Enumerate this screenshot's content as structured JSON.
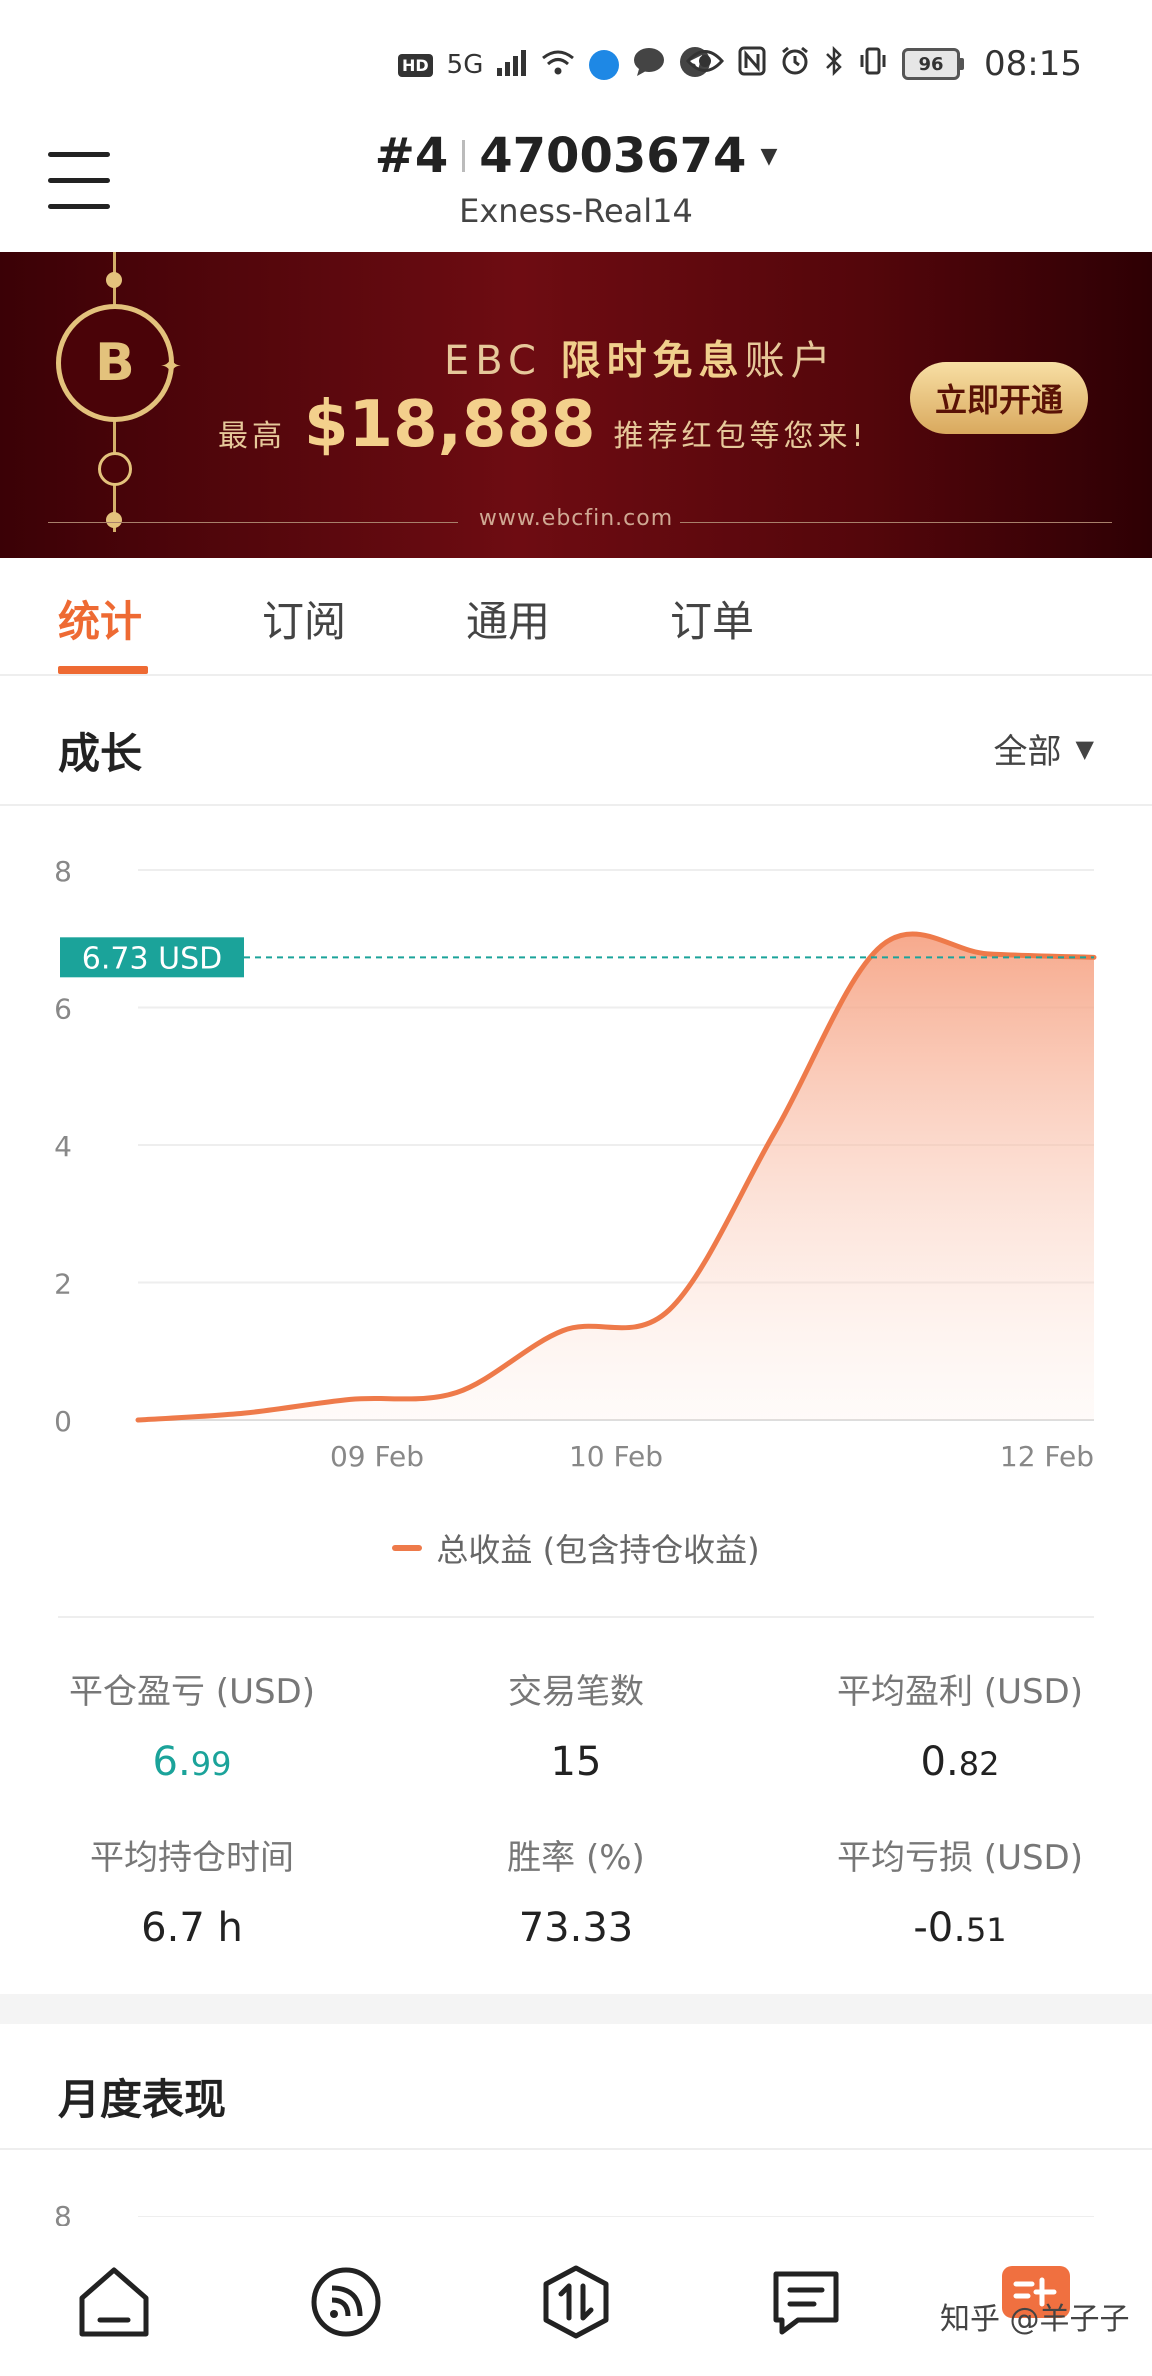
{
  "status_bar": {
    "hd": "HD",
    "network": "5G",
    "battery": "96",
    "time": "08:15"
  },
  "header": {
    "account_prefix": "#4",
    "account_number": "47003674",
    "server": "Exness-Real14"
  },
  "banner": {
    "brand": "EBC",
    "headline_pre": "EBC",
    "headline_highlight": "限时免息",
    "headline_post": "账户",
    "line2_pre": "最高",
    "amount": "$18,888",
    "line2_post": "推荐红包等您来!",
    "cta": "立即开通",
    "url": "www.ebcfin.com"
  },
  "tabs": [
    {
      "label": "统计",
      "active": true
    },
    {
      "label": "订阅",
      "active": false
    },
    {
      "label": "通用",
      "active": false
    },
    {
      "label": "订单",
      "active": false
    }
  ],
  "growth": {
    "title": "成长",
    "filter": "全部"
  },
  "chart_data": {
    "type": "area",
    "title": "",
    "xlabel": "",
    "ylabel": "",
    "x_ticks": [
      "09 Feb",
      "10 Feb",
      "12 Feb"
    ],
    "y_ticks": [
      "0",
      "2",
      "4",
      "6",
      "8"
    ],
    "ylim": [
      0,
      8
    ],
    "current_label": "6.73 USD",
    "current_value": 6.73,
    "series": [
      {
        "name": "总收益 (包含持仓收益)",
        "color": "#ee7a4a",
        "points": [
          {
            "x": "08 Feb",
            "y": 0.0
          },
          {
            "x": "08 Feb",
            "y": 0.1
          },
          {
            "x": "09 Feb",
            "y": 0.3
          },
          {
            "x": "09 Feb",
            "y": 0.4
          },
          {
            "x": "10 Feb",
            "y": 1.3
          },
          {
            "x": "10 Feb",
            "y": 1.6
          },
          {
            "x": "11 Feb",
            "y": 4.2
          },
          {
            "x": "11 Feb",
            "y": 6.9
          },
          {
            "x": "12 Feb",
            "y": 6.78
          },
          {
            "x": "12 Feb",
            "y": 6.73
          }
        ]
      }
    ]
  },
  "legend": {
    "label": "总收益 (包含持仓收益)"
  },
  "stats": [
    {
      "label": "平仓盈亏 (USD)",
      "value_main": "6.",
      "value_small": "99",
      "color": "#1ba39a"
    },
    {
      "label": "交易笔数",
      "value_main": "15",
      "value_small": ""
    },
    {
      "label": "平均盈利 (USD)",
      "value_main": "0.",
      "value_small": "82"
    },
    {
      "label": "平均持仓时间",
      "value_main": "6.7 h",
      "value_small": ""
    },
    {
      "label": "胜率 (%)",
      "value_main": "73.33",
      "value_small": ""
    },
    {
      "label": "平均亏损 (USD)",
      "value_main": "-0.",
      "value_small": "51"
    }
  ],
  "monthly": {
    "title": "月度表现",
    "first_tick": "8"
  },
  "bottom_nav": [
    {
      "icon": "home-icon"
    },
    {
      "icon": "feed-icon"
    },
    {
      "icon": "trade-icon"
    },
    {
      "icon": "messages-icon"
    },
    {
      "icon": "profile-icon"
    }
  ],
  "watermark": "知乎 @羊子子",
  "colors": {
    "accent": "#ee6a33",
    "positive": "#1ba39a",
    "banner_bg": "#5a0a10",
    "banner_gold": "#e3c27c"
  }
}
